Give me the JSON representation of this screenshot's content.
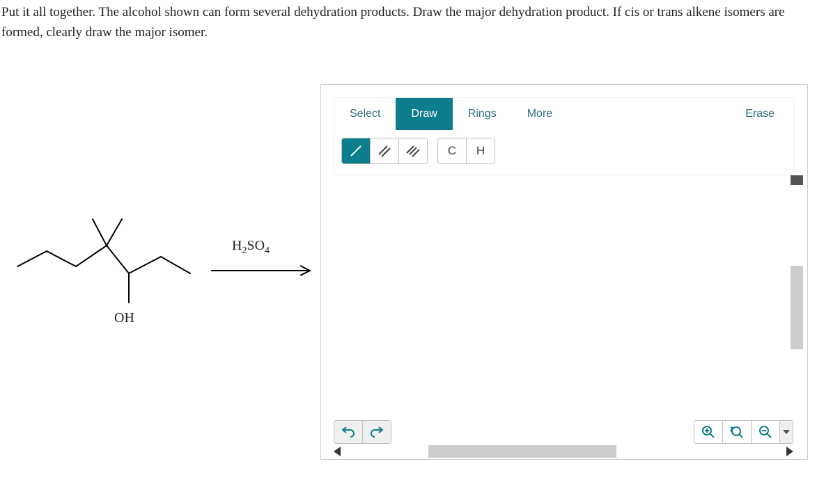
{
  "question": {
    "text": "Put it all together. The alcohol shown can form several dehydration products. Draw the major dehydration product. If cis or trans alkene isomers are formed, clearly draw the major isomer."
  },
  "reagent": {
    "formula_html": "H2SO4",
    "substituent": "OH"
  },
  "editor": {
    "tabs": {
      "select": "Select",
      "draw": "Draw",
      "rings": "Rings",
      "more": "More",
      "erase": "Erase",
      "active": "draw"
    },
    "tools": {
      "single_bond": "/",
      "double_bond": "//",
      "triple_bond": "///",
      "carbon": "C",
      "hydrogen": "H",
      "active": "single_bond"
    }
  }
}
